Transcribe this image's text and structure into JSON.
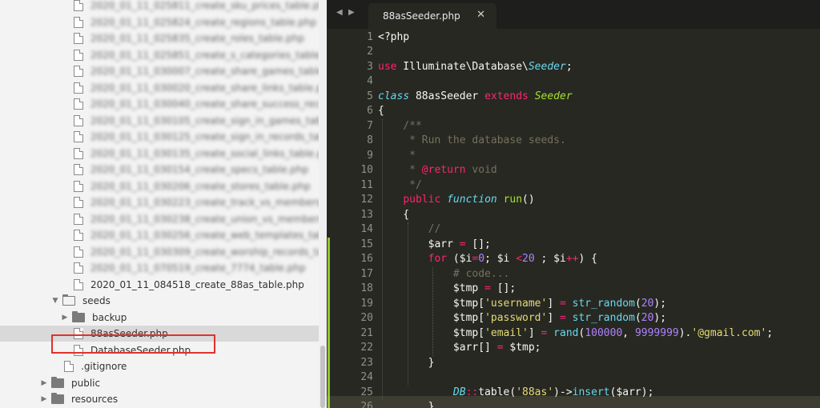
{
  "sidebar": {
    "blurred_files": [
      "2020_01_11_025811_create_sku_prices_table.php",
      "2020_01_11_025824_create_regions_table.php",
      "2020_01_11_025835_create_roles_table.php",
      "2020_01_11_025851_create_s_categories_table.php",
      "2020_01_11_030007_create_share_games_table.php",
      "2020_01_11_030020_create_share_links_table.php",
      "2020_01_11_030040_create_share_success_records_table.php",
      "2020_01_11_030105_create_sign_in_games_table.php",
      "2020_01_11_030125_create_sign_in_records_table.php",
      "2020_01_11_030135_create_social_links_table.php",
      "2020_01_11_030154_create_specs_table.php",
      "2020_01_11_030206_create_stores_table.php",
      "2020_01_11_030223_create_track_vs_members_table.php",
      "2020_01_11_030238_create_union_vs_members_table.php",
      "2020_01_11_030256_create_web_templates_table.php",
      "2020_01_11_030309_create_worship_records_table.php",
      "2020_01_11_070519_create_7774_table.php"
    ],
    "last_migration": "2020_01_11_084518_create_88as_table.php",
    "seeds_folder": "seeds",
    "backup_folder": "backup",
    "selected_file": "88asSeeder.php",
    "database_seeder": "DatabaseSeeder.php",
    "gitignore": ".gitignore",
    "public_folder": "public",
    "resources_folder": "resources"
  },
  "editor": {
    "nav_left": "◀",
    "nav_right": "▶",
    "tab_title": "88asSeeder.php",
    "tab_close": "✕",
    "colors": {
      "keyword": "#f92672",
      "storage": "#66d9ef",
      "string": "#e6db74",
      "number": "#ae81ff",
      "comment": "#75715e",
      "plain": "#f8f8f2",
      "func": "#a6e22e"
    },
    "lines": [
      [
        [
          "<?php",
          "plain"
        ]
      ],
      [],
      [
        [
          "use",
          "keyword"
        ],
        [
          " Illuminate\\Database\\",
          "plain"
        ],
        [
          "Seeder",
          "storage-it"
        ],
        [
          ";",
          "plain"
        ]
      ],
      [],
      [
        [
          "class",
          "storage-it"
        ],
        [
          " 88asSeeder ",
          "plain"
        ],
        [
          "extends",
          "keyword"
        ],
        [
          " ",
          "plain"
        ],
        [
          "Seeder",
          "func-it"
        ]
      ],
      [
        [
          "{",
          "plain"
        ]
      ],
      [
        [
          "    /**",
          "comment"
        ]
      ],
      [
        [
          "     * Run the database seeds.",
          "comment"
        ]
      ],
      [
        [
          "     *",
          "comment"
        ]
      ],
      [
        [
          "     * ",
          "comment"
        ],
        [
          "@return",
          "keyword"
        ],
        [
          " void",
          "comment"
        ]
      ],
      [
        [
          "     */",
          "comment"
        ]
      ],
      [
        [
          "    ",
          "plain"
        ],
        [
          "public",
          "keyword"
        ],
        [
          " ",
          "plain"
        ],
        [
          "function",
          "storage-it"
        ],
        [
          " ",
          "plain"
        ],
        [
          "run",
          "func"
        ],
        [
          "()",
          "plain"
        ]
      ],
      [
        [
          "    {",
          "plain"
        ]
      ],
      [
        [
          "        //",
          "comment"
        ]
      ],
      [
        [
          "        $arr ",
          "plain"
        ],
        [
          "=",
          "keyword"
        ],
        [
          " [];",
          "plain"
        ]
      ],
      [
        [
          "        ",
          "plain"
        ],
        [
          "for",
          "keyword"
        ],
        [
          " ($i",
          "plain"
        ],
        [
          "=",
          "keyword"
        ],
        [
          "0",
          "number"
        ],
        [
          "; $i ",
          "plain"
        ],
        [
          "<",
          "keyword"
        ],
        [
          "20",
          "number"
        ],
        [
          " ; $i",
          "plain"
        ],
        [
          "++",
          "keyword"
        ],
        [
          ") {",
          "plain"
        ]
      ],
      [
        [
          "            # code...",
          "comment"
        ]
      ],
      [
        [
          "            $tmp ",
          "plain"
        ],
        [
          "=",
          "keyword"
        ],
        [
          " [];",
          "plain"
        ]
      ],
      [
        [
          "            $tmp[",
          "plain"
        ],
        [
          "'username'",
          "string"
        ],
        [
          "] ",
          "plain"
        ],
        [
          "=",
          "keyword"
        ],
        [
          " ",
          "plain"
        ],
        [
          "str_random",
          "storage"
        ],
        [
          "(",
          "plain"
        ],
        [
          "20",
          "number"
        ],
        [
          ");",
          "plain"
        ]
      ],
      [
        [
          "            $tmp[",
          "plain"
        ],
        [
          "'password'",
          "string"
        ],
        [
          "] ",
          "plain"
        ],
        [
          "=",
          "keyword"
        ],
        [
          " ",
          "plain"
        ],
        [
          "str_random",
          "storage"
        ],
        [
          "(",
          "plain"
        ],
        [
          "20",
          "number"
        ],
        [
          ");",
          "plain"
        ]
      ],
      [
        [
          "            $tmp[",
          "plain"
        ],
        [
          "'email'",
          "string"
        ],
        [
          "] ",
          "plain"
        ],
        [
          "=",
          "keyword"
        ],
        [
          " ",
          "plain"
        ],
        [
          "rand",
          "storage"
        ],
        [
          "(",
          "plain"
        ],
        [
          "100000",
          "number"
        ],
        [
          ", ",
          "plain"
        ],
        [
          "9999999",
          "number"
        ],
        [
          ").",
          "plain"
        ],
        [
          "'@gmail.com'",
          "string"
        ],
        [
          ";",
          "plain"
        ]
      ],
      [
        [
          "            $arr[] ",
          "plain"
        ],
        [
          "=",
          "keyword"
        ],
        [
          " $tmp;",
          "plain"
        ]
      ],
      [
        [
          "        }",
          "plain"
        ]
      ],
      [],
      [
        [
          "            ",
          "plain"
        ],
        [
          "DB",
          "storage-it"
        ],
        [
          "::",
          "keyword"
        ],
        [
          "table(",
          "plain"
        ],
        [
          "'88as'",
          "string"
        ],
        [
          ")->",
          "plain"
        ],
        [
          "insert",
          "storage"
        ],
        [
          "($arr);",
          "plain"
        ]
      ],
      [
        [
          "        }",
          "plain"
        ]
      ]
    ]
  }
}
